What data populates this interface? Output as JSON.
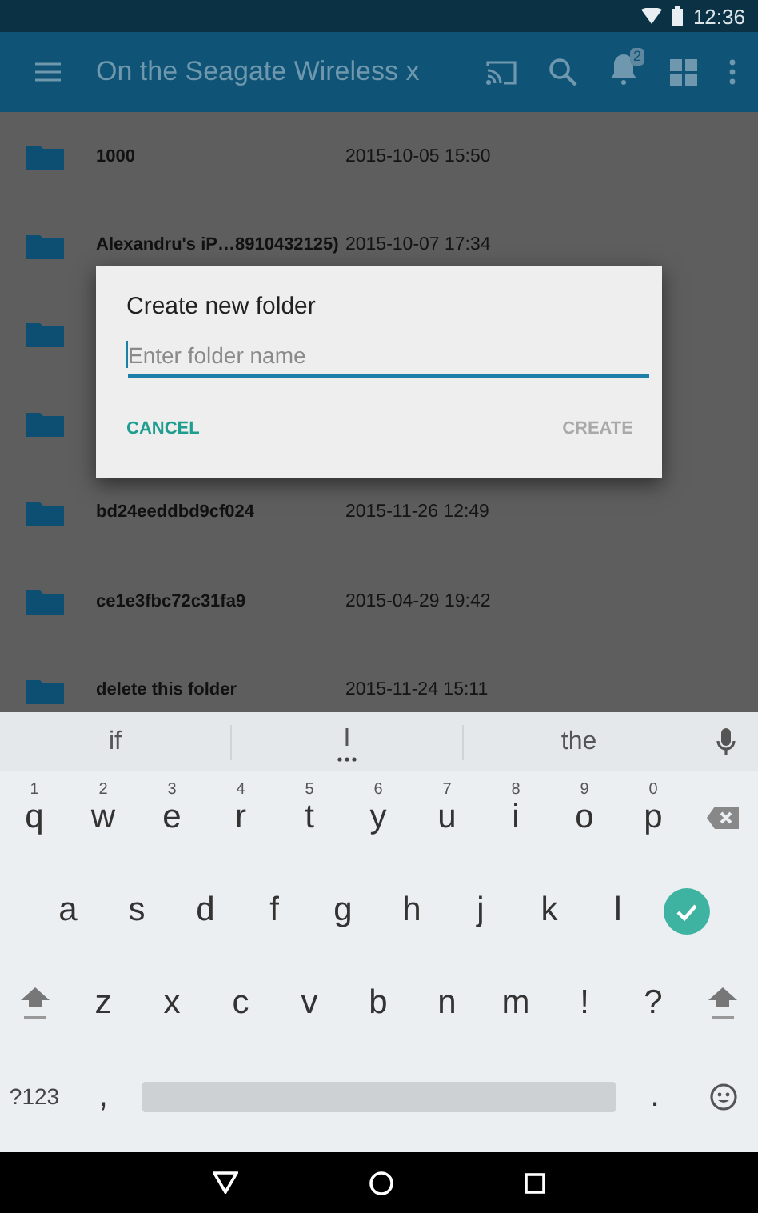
{
  "status_bar": {
    "time": "12:36"
  },
  "app_bar": {
    "title": "On the Seagate Wireless x",
    "notification_count": "2"
  },
  "files": [
    {
      "kind": "folder",
      "name": "1000",
      "date": "2015-10-05 15:50"
    },
    {
      "kind": "folder",
      "name": "Alexandru's iP…8910432125)",
      "date": "2015-10-07 17:34"
    },
    {
      "kind": "folder"
    },
    {
      "kind": "folder"
    },
    {
      "kind": "folder",
      "name": "bd24eeddbd9cf024",
      "date": "2015-11-26 12:49"
    },
    {
      "kind": "folder",
      "name": "ce1e3fbc72c31fa9",
      "date": "2015-04-29 19:42"
    },
    {
      "kind": "folder",
      "name": "delete this folder",
      "date": "2015-11-24 15:11"
    }
  ],
  "dialog": {
    "title": "Create new folder",
    "placeholder": "Enter folder name",
    "buttons": [
      {
        "label": "CANCEL",
        "disabled": false
      },
      {
        "label": "CREATE",
        "disabled": true
      }
    ]
  },
  "keyboard": {
    "suggestions": [
      "if",
      "I",
      "the"
    ],
    "rows": [
      [
        {
          "kind": "char",
          "label": "q",
          "hint": "1"
        },
        {
          "kind": "char",
          "label": "w",
          "hint": "2"
        },
        {
          "kind": "char",
          "label": "e",
          "hint": "3"
        },
        {
          "kind": "char",
          "label": "r",
          "hint": "4"
        },
        {
          "kind": "char",
          "label": "t",
          "hint": "5"
        },
        {
          "kind": "char",
          "label": "y",
          "hint": "6"
        },
        {
          "kind": "char",
          "label": "u",
          "hint": "7"
        },
        {
          "kind": "char",
          "label": "i",
          "hint": "8"
        },
        {
          "kind": "char",
          "label": "o",
          "hint": "9"
        },
        {
          "kind": "char",
          "label": "p",
          "hint": "0"
        },
        {
          "kind": "backspace"
        }
      ],
      [
        {
          "kind": "char",
          "label": "a"
        },
        {
          "kind": "char",
          "label": "s"
        },
        {
          "kind": "char",
          "label": "d"
        },
        {
          "kind": "char",
          "label": "f"
        },
        {
          "kind": "char",
          "label": "g"
        },
        {
          "kind": "char",
          "label": "h"
        },
        {
          "kind": "char",
          "label": "j"
        },
        {
          "kind": "char",
          "label": "k"
        },
        {
          "kind": "char",
          "label": "l"
        },
        {
          "kind": "enter"
        }
      ],
      [
        {
          "kind": "shift"
        },
        {
          "kind": "char",
          "label": "z"
        },
        {
          "kind": "char",
          "label": "x"
        },
        {
          "kind": "char",
          "label": "c"
        },
        {
          "kind": "char",
          "label": "v"
        },
        {
          "kind": "char",
          "label": "b"
        },
        {
          "kind": "char",
          "label": "n"
        },
        {
          "kind": "char",
          "label": "m"
        },
        {
          "kind": "char",
          "label": "!"
        },
        {
          "kind": "char",
          "label": "?"
        },
        {
          "kind": "shift"
        }
      ]
    ],
    "bottom_row": [
      {
        "kind": "mode",
        "label": "?123"
      },
      {
        "kind": "char",
        "label": ","
      },
      {
        "kind": "space"
      },
      {
        "kind": "char",
        "label": "."
      },
      {
        "kind": "emoji"
      }
    ]
  }
}
